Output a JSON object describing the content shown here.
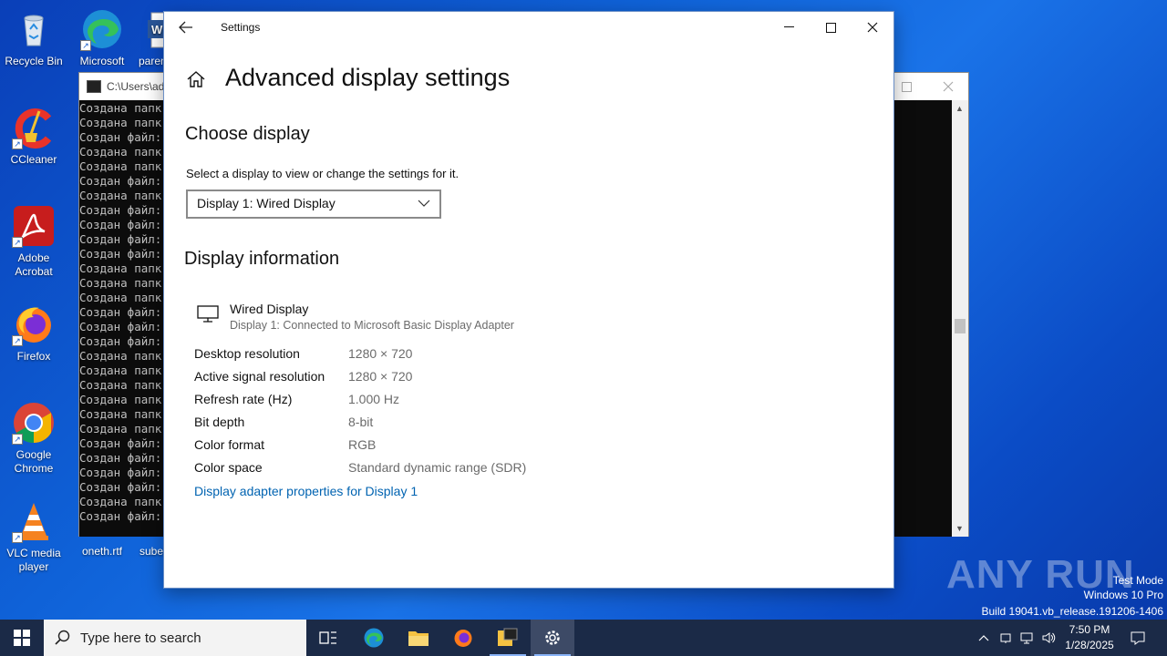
{
  "desktop": {
    "icons": [
      {
        "label": "Recycle Bin"
      },
      {
        "label": "Microsoft Edge"
      },
      {
        "label": "paren"
      },
      {
        "label": "CCleaner"
      },
      {
        "label": "Adobe Acrobat"
      },
      {
        "label": "Firefox"
      },
      {
        "label": "Google Chrome"
      },
      {
        "label": "VLC media player"
      },
      {
        "label": "oneth.rtf"
      },
      {
        "label": "subel"
      }
    ]
  },
  "console": {
    "title": "C:\\Users\\ad",
    "lines": [
      "Создана папк",
      "Создана папк",
      "Создан файл:",
      "Создана папк",
      "Создана папк",
      "Создан файл:",
      "Создана папк",
      "Создан файл:",
      "Создан файл:",
      "Создан файл:",
      "Создан файл:",
      "Создана папк",
      "Создана папк",
      "Создана папк",
      "Создан файл:",
      "Создан файл:",
      "Создан файл:",
      "Создана папк",
      "Создана папк",
      "Создана папк",
      "Создана папк",
      "Создана папк",
      "Создана папк",
      "Создан файл:",
      "Создан файл:",
      "Создан файл:",
      "Создан файл:",
      "Создана папк",
      "Создан файл:"
    ]
  },
  "settings": {
    "window_title": "Settings",
    "page_title": "Advanced display settings",
    "choose_display": {
      "heading": "Choose display",
      "description": "Select a display to view or change the settings for it.",
      "selected": "Display 1: Wired Display"
    },
    "display_info": {
      "heading": "Display information",
      "name": "Wired Display",
      "subtitle": "Display 1: Connected to Microsoft Basic Display Adapter",
      "rows": [
        {
          "key": "Desktop resolution",
          "value": "1280 × 720"
        },
        {
          "key": "Active signal resolution",
          "value": "1280 × 720"
        },
        {
          "key": "Refresh rate (Hz)",
          "value": "1.000 Hz"
        },
        {
          "key": "Bit depth",
          "value": "8-bit"
        },
        {
          "key": "Color format",
          "value": "RGB"
        },
        {
          "key": "Color space",
          "value": "Standard dynamic range (SDR)"
        }
      ],
      "link": "Display adapter properties for Display 1"
    }
  },
  "taskbar": {
    "search_placeholder": "Type here to search",
    "time": "7:50 PM",
    "date": "1/28/2025"
  },
  "watermark": {
    "line1": "Test Mode",
    "line2": "Windows 10 Pro",
    "line3": "Build 19041.vb_release.191206-1406",
    "brand": "ANY RUN"
  }
}
